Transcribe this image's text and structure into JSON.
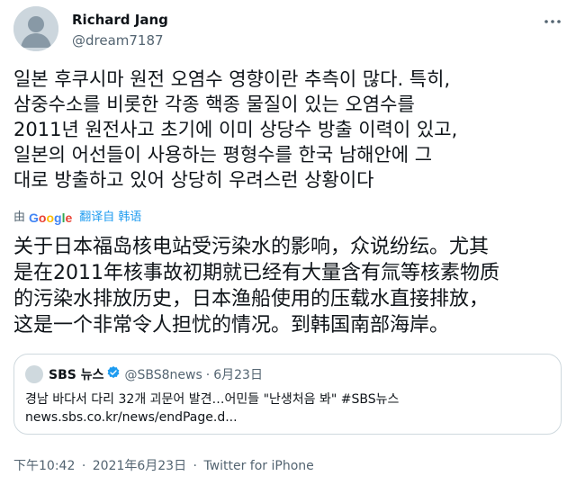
{
  "author": {
    "display_name": "Richard Jang",
    "handle": "@dream7187"
  },
  "tweet": {
    "text": "일본 후쿠시마 원전 오염수 영향이란 추측이 많다. 특히,\n삼중수소를 비롯한 각종 핵종 물질이 있는 오염수를\n2011년 원전사고 초기에 이미 상당수 방출 이력이 있고,\n일본의 어선들이 사용하는 평형수를 한국 남해안에 그\n대로 방출하고 있어 상당히 우려스런 상황이다"
  },
  "translation": {
    "prefix": "由",
    "provider": "Google",
    "link_label": "翻译自 韩语",
    "text": "关于日本福岛核电站受污染水的影响，众说纷纭。尤其\n是在2011年核事故初期就已经有大量含有氚等核素物质\n的污染水排放历史，日本渔船使用的压载水直接排放，\n这是一个非常令人担忧的情况。到韩国南部海岸。"
  },
  "quote": {
    "name": "SBS 뉴스",
    "handle": "@SBS8news",
    "separator": "·",
    "date": "6月23日",
    "text": "경남 바다서 다리 32개 괴문어 발견…어민들 \"난생처음 봐\" #SBS뉴스",
    "link": "news.sbs.co.kr/news/endPage.d..."
  },
  "meta": {
    "time": "下午10:42",
    "date": "2021年6月23日",
    "source": "Twitter for iPhone",
    "separator": "·"
  },
  "colors": {
    "accent": "#1d9bf0",
    "secondary_text": "#536471",
    "border": "#cfd9de"
  },
  "icons": {
    "more": "more-horizontal-icon",
    "verified": "verified-badge-icon",
    "avatar": "default-avatar-icon"
  }
}
